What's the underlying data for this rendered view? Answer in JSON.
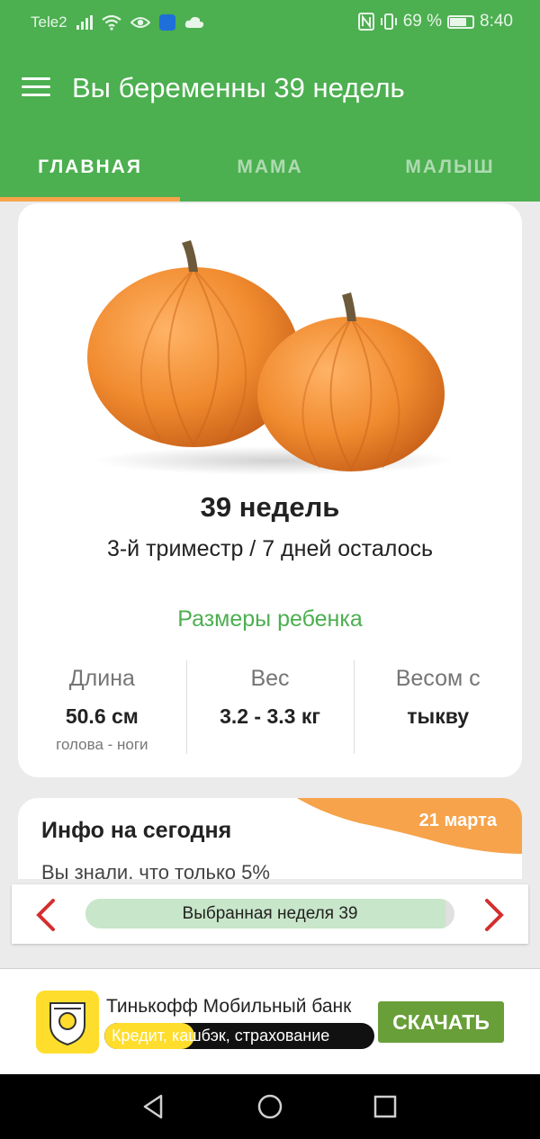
{
  "status_bar": {
    "carrier": "Tele2",
    "battery": "69 %",
    "time": "8:40",
    "icons": [
      "signal-icon",
      "wifi-icon",
      "eye-icon",
      "shield-icon",
      "cloud-icon",
      "nfc-icon",
      "vibrate-icon",
      "battery-icon"
    ]
  },
  "app_bar": {
    "title": "Вы беременны 39 недель",
    "menu_icon": "hamburger-menu-icon"
  },
  "tabs": [
    {
      "label": "ГЛАВНАЯ",
      "active": true
    },
    {
      "label": "МАМА",
      "active": false
    },
    {
      "label": "МАЛЫШ",
      "active": false
    }
  ],
  "colors": {
    "primary": "#4caf50",
    "accent": "#f6a34b",
    "nav_arrow": "#d32f2f",
    "ad_button": "#689f38",
    "brand_yellow": "#ffdd2d"
  },
  "main_card": {
    "image": "pumpkins",
    "week_title": "39 недель",
    "week_subtitle": "3-й триместр / 7 дней осталось",
    "sizes_heading": "Размеры ребенка",
    "stats": [
      {
        "label": "Длина",
        "value": "50.6 см",
        "note": "голова - ноги"
      },
      {
        "label": "Вес",
        "value": "3.2 - 3.3 кг",
        "note": ""
      },
      {
        "label": "Весом с",
        "value": "тыкву",
        "note": ""
      }
    ]
  },
  "info_card": {
    "title": "Инфо на сегодня",
    "date": "21 марта",
    "text": "Вы знали, что только 5%"
  },
  "week_selector": {
    "label": "Выбранная неделя 39",
    "progress": 0.975,
    "prev_icon": "chevron-left-icon",
    "next_icon": "chevron-right-icon"
  },
  "ad": {
    "title": "Тинькофф Мобильный банк",
    "subtitle": "Кредит, кашбэк, страхование",
    "button": "СКАЧАТЬ",
    "logo_icon": "tinkoff-logo-icon"
  },
  "nav_bar": {
    "buttons": [
      "back-icon",
      "home-icon",
      "recents-icon"
    ]
  }
}
